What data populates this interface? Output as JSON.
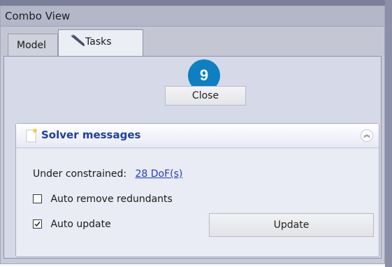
{
  "window": {
    "title": "Combo View"
  },
  "tabs": [
    {
      "label": "Model",
      "active": false
    },
    {
      "label": "Tasks",
      "active": true,
      "icon": "pencil-icon"
    }
  ],
  "step_badge": "9",
  "close_label": "Close",
  "solver": {
    "title": "Solver messages",
    "status_label": "Under constrained:",
    "dof_link": "28 DoF(s)",
    "auto_remove": {
      "label": "Auto remove redundants",
      "checked": false
    },
    "auto_update": {
      "label": "Auto update",
      "checked": true
    },
    "update_label": "Update"
  },
  "colors": {
    "accent_title": "#1f3f9a",
    "link": "#1d3fbf",
    "badge": "#0f7fc3"
  }
}
